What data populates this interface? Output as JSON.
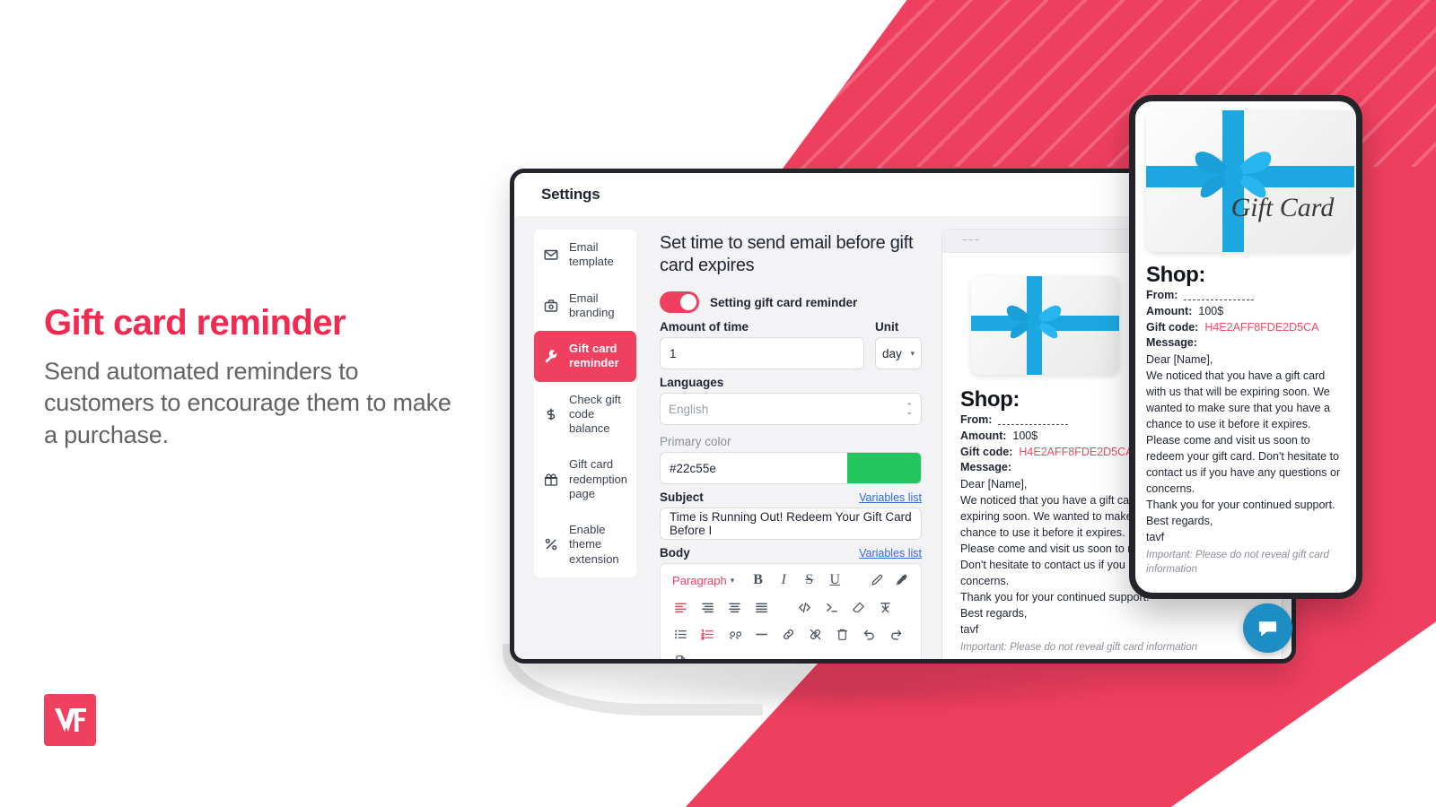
{
  "brand": {
    "accent_pink": "#ef4060",
    "headline_pink": "#f02a50",
    "logo_text": "VF"
  },
  "marketing": {
    "headline": "Gift card reminder",
    "subcopy": "Send automated reminders to customers to encourage them to make a purchase."
  },
  "window": {
    "title": "Settings"
  },
  "sidebar": {
    "items": [
      {
        "label": "Email template",
        "icon": "envelope-icon",
        "active": false
      },
      {
        "label": "Email branding",
        "icon": "briefcase-icon",
        "active": false
      },
      {
        "label": "Gift card reminder",
        "icon": "wrench-icon",
        "active": true
      },
      {
        "label": "Check gift code balance",
        "icon": "dollar-icon",
        "active": false
      },
      {
        "label": "Gift card redemption page",
        "icon": "gift-icon",
        "active": false
      },
      {
        "label": "Enable theme extension",
        "icon": "percent-icon",
        "active": false
      }
    ]
  },
  "form": {
    "title": "Set time to send email before gift card expires",
    "toggle": {
      "label": "Setting gift card reminder",
      "on": true
    },
    "amount_label": "Amount of time",
    "amount_value": "1",
    "unit_label": "Unit",
    "unit_value": "day",
    "languages_label": "Languages",
    "languages_value": "English",
    "primary_color_label": "Primary color",
    "primary_color_value": "#22c55e",
    "subject_label": "Subject",
    "subject_value": "Time is Running Out! Redeem Your Gift Card Before I",
    "body_label": "Body",
    "variables_link": "Variables list",
    "editor": {
      "block_format": "Paragraph",
      "row1": [
        "bold",
        "italic",
        "strikethrough",
        "underline",
        "highlighter-icon",
        "eyedropper-icon"
      ],
      "row2": [
        "align-left-icon",
        "align-center-icon",
        "align-right-icon",
        "align-justify-icon",
        "code-icon",
        "code-block-icon",
        "eraser-icon",
        "clear-format-icon"
      ],
      "row3": [
        "bullet-list-icon",
        "numbered-list-icon",
        "blockquote-icon",
        "horizontal-rule-icon",
        "link-icon",
        "unlink-icon",
        "trash-icon",
        "undo-icon",
        "redo-icon"
      ],
      "row4": [
        "page-icon"
      ]
    }
  },
  "preview": {
    "shop_title": "Shop:",
    "from_label": "From:",
    "from_value": "",
    "amount_label": "Amount:",
    "amount_value": "100$",
    "giftcode_label": "Gift code:",
    "giftcode_value": "H4E2AFF8FDE2D5CA",
    "message_label": "Message:",
    "greeting": "Dear [Name],",
    "paragraphs": [
      "We noticed that you have a gift card with us that will be expiring soon. We wanted to make sure that you have a chance to use it before it expires.",
      "Please come and visit us soon to redeem your gift card. Don't hesitate to contact us if you have any questions or concerns.",
      "Thank you for your continued support.",
      "Best regards,",
      "tavf"
    ],
    "note": "Important: Please do not reveal gift card information",
    "giftcard_text": "Gift Card"
  },
  "chat": {
    "icon": "chat-bubble-icon"
  }
}
